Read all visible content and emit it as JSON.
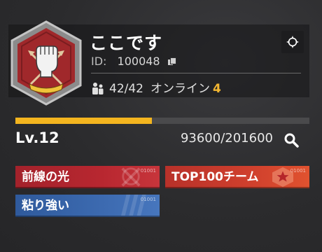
{
  "club": {
    "name": "ここです",
    "id_label": "ID:",
    "id_value": "100048",
    "members": "42/42",
    "online_label": "オンライン",
    "online_count": "4"
  },
  "level": {
    "label": "Lv.12",
    "xp_text": "93600/201600",
    "progress_fraction": 0.464
  },
  "badges": [
    {
      "label": "前線の光",
      "serial": "01001",
      "color": "red",
      "icon": "crossed-swords-icon"
    },
    {
      "label": "TOP100チーム",
      "serial": "01001",
      "color": "orange-red",
      "icon": "star-crest-icon"
    },
    {
      "label": "粘り強い",
      "serial": "01001",
      "color": "blue",
      "icon": "stripes-icon"
    }
  ],
  "icons": {
    "emblem": "raised-fist-emblem-icon",
    "settings": "settings-icon",
    "copy": "copy-icon",
    "members": "members-icon",
    "search": "search-icon"
  },
  "colors": {
    "accent": "#f4b51f",
    "background": "#2b2b2d",
    "badge_red": "#b82730",
    "badge_orange": "#d0402d",
    "badge_blue": "#3c6ab0"
  }
}
